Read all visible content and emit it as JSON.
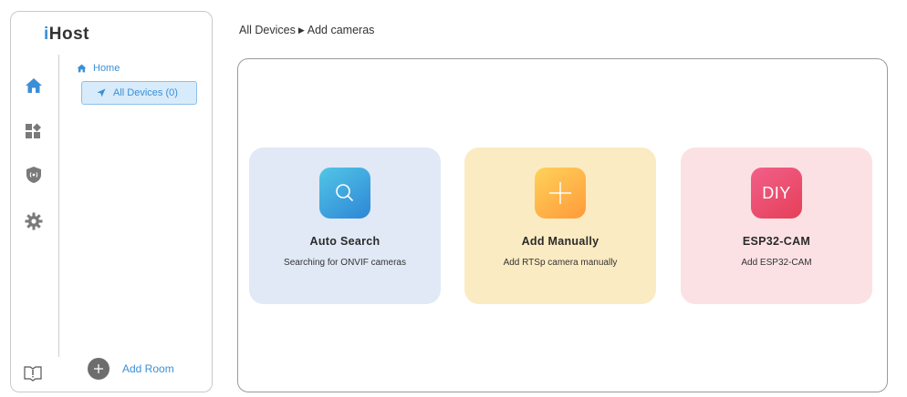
{
  "brand": {
    "prefix": "i",
    "rest": "Host"
  },
  "sidebar": {
    "rail_icons": [
      {
        "name": "home-icon",
        "active": true
      },
      {
        "name": "dashboard-icon",
        "active": false
      },
      {
        "name": "security-shield-icon",
        "active": false
      },
      {
        "name": "settings-gear-icon",
        "active": false
      }
    ],
    "rooms": {
      "home_label": "Home",
      "all_devices_label": "All Devices (0)"
    },
    "add_room_label": "Add Room",
    "guide_icon": "guide-book-icon"
  },
  "breadcrumb": {
    "parent": "All Devices",
    "separator": "▶",
    "current": "Add cameras"
  },
  "cards": {
    "auto": {
      "icon": "search-icon",
      "title": "Auto Search",
      "subtitle": "Searching for ONVIF cameras"
    },
    "manual": {
      "icon": "plus-icon",
      "title": "Add Manually",
      "subtitle": "Add RTSp camera manually"
    },
    "esp": {
      "icon_text": "DIY",
      "title": "ESP32-CAM",
      "subtitle": "Add ESP32-CAM"
    }
  },
  "colors": {
    "accent": "#3b8fd6",
    "auto_card_bg": "#e0e9f5",
    "manual_card_bg": "#fbebc2",
    "esp_card_bg": "#fbe1e4"
  }
}
